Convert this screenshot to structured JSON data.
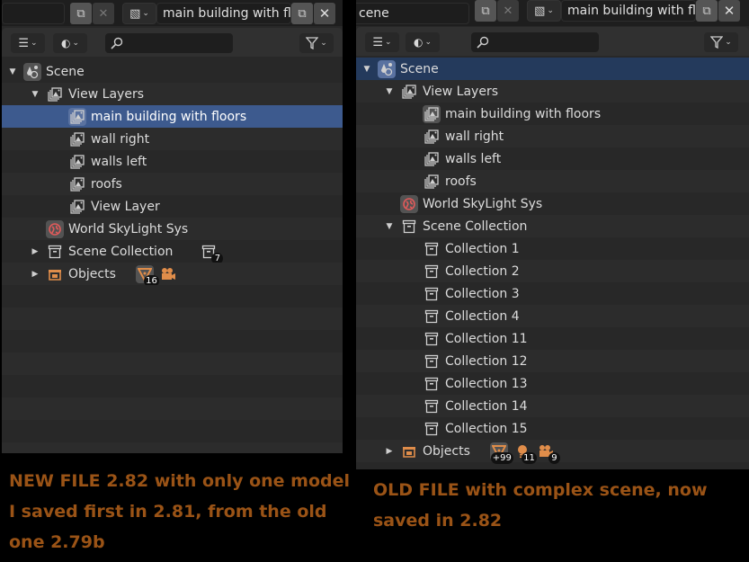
{
  "left": {
    "topbar": {
      "scene_field": "",
      "viewlayer_field": "main building with fl.."
    },
    "rows": [
      {
        "depth": 0,
        "disclosure": "open",
        "icon": "scene-icon",
        "label": "Scene",
        "boxed": true
      },
      {
        "depth": 1,
        "disclosure": "open",
        "icon": "view-layers-icon",
        "label": "View Layers"
      },
      {
        "depth": 2,
        "disclosure": "",
        "icon": "render-layer-icon",
        "label": "main building with floors",
        "selected": true,
        "boxed": true
      },
      {
        "depth": 2,
        "disclosure": "",
        "icon": "render-layer-icon",
        "label": "wall right"
      },
      {
        "depth": 2,
        "disclosure": "",
        "icon": "render-layer-icon",
        "label": "walls left"
      },
      {
        "depth": 2,
        "disclosure": "",
        "icon": "render-layer-icon",
        "label": "roofs"
      },
      {
        "depth": 2,
        "disclosure": "",
        "icon": "render-layer-icon",
        "label": "View Layer"
      },
      {
        "depth": 1,
        "disclosure": "",
        "icon": "world-icon",
        "label": "World SkyLight Sys",
        "boxed": true
      },
      {
        "depth": 1,
        "disclosure": "closed",
        "icon": "collection-icon",
        "label": "Scene Collection",
        "extras": [
          {
            "icon": "collection-icon",
            "count": "7"
          }
        ]
      },
      {
        "depth": 1,
        "disclosure": "closed",
        "icon": "objects-icon",
        "label": "Objects",
        "extras": [
          {
            "icon": "mesh-icon",
            "count": "16",
            "boxed": true
          },
          {
            "icon": "camera-icon",
            "count": ""
          }
        ]
      }
    ],
    "empty_rows": 8
  },
  "right": {
    "topbar": {
      "scene_field": "cene",
      "viewlayer_field": "main building with fl.."
    },
    "rows": [
      {
        "depth": 0,
        "disclosure": "open",
        "icon": "scene-icon",
        "label": "Scene",
        "boxed": true,
        "active": true
      },
      {
        "depth": 1,
        "disclosure": "open",
        "icon": "view-layers-icon",
        "label": "View Layers"
      },
      {
        "depth": 2,
        "disclosure": "",
        "icon": "render-layer-icon",
        "label": "main building with floors",
        "boxed": true
      },
      {
        "depth": 2,
        "disclosure": "",
        "icon": "render-layer-icon",
        "label": "wall right"
      },
      {
        "depth": 2,
        "disclosure": "",
        "icon": "render-layer-icon",
        "label": "walls left"
      },
      {
        "depth": 2,
        "disclosure": "",
        "icon": "render-layer-icon",
        "label": "roofs"
      },
      {
        "depth": 1,
        "disclosure": "",
        "icon": "world-icon",
        "label": "World SkyLight Sys",
        "boxed": true
      },
      {
        "depth": 1,
        "disclosure": "open",
        "icon": "collection-icon",
        "label": "Scene Collection"
      },
      {
        "depth": 2,
        "disclosure": "",
        "icon": "collection-icon",
        "label": "Collection 1"
      },
      {
        "depth": 2,
        "disclosure": "",
        "icon": "collection-icon",
        "label": "Collection 2"
      },
      {
        "depth": 2,
        "disclosure": "",
        "icon": "collection-icon",
        "label": "Collection 3"
      },
      {
        "depth": 2,
        "disclosure": "",
        "icon": "collection-icon",
        "label": "Collection 4"
      },
      {
        "depth": 2,
        "disclosure": "",
        "icon": "collection-icon",
        "label": "Collection 11"
      },
      {
        "depth": 2,
        "disclosure": "",
        "icon": "collection-icon",
        "label": "Collection 12"
      },
      {
        "depth": 2,
        "disclosure": "",
        "icon": "collection-icon",
        "label": "Collection 13"
      },
      {
        "depth": 2,
        "disclosure": "",
        "icon": "collection-icon",
        "label": "Collection 14"
      },
      {
        "depth": 2,
        "disclosure": "",
        "icon": "collection-icon",
        "label": "Collection 15"
      },
      {
        "depth": 1,
        "disclosure": "closed",
        "icon": "objects-icon",
        "label": "Objects",
        "extras": [
          {
            "icon": "mesh-icon",
            "count": "+99",
            "boxed": true
          },
          {
            "icon": "light-icon",
            "count": "11"
          },
          {
            "icon": "camera-icon",
            "count": "9"
          }
        ]
      }
    ],
    "empty_rows": 0
  },
  "captions": {
    "left": "NEW FILE 2.82 with only one model I saved first in 2.81, from the old one 2.79b",
    "right": "OLD FILE with complex scene, now saved in 2.82"
  },
  "colors": {
    "selected_row": "#3d5a8e",
    "active_row": "#243a5c",
    "caption": "#9a5316",
    "object_icon": "#e08d4a",
    "world_icon": "#e05a5a"
  }
}
